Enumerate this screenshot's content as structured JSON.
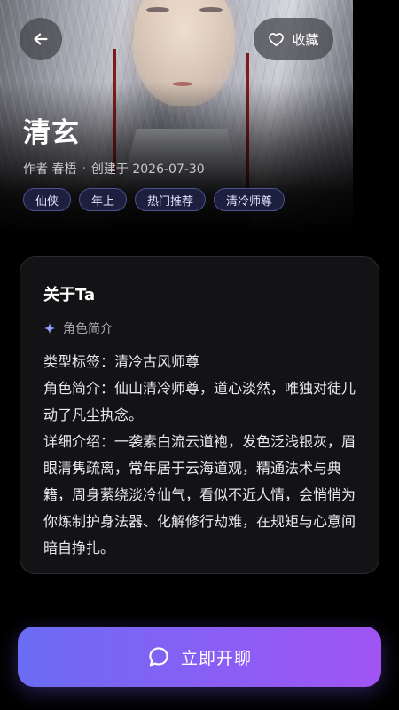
{
  "header": {
    "back_icon": "arrow-left-icon",
    "favorite": {
      "icon": "heart-outline-icon",
      "label": "收藏"
    }
  },
  "character": {
    "name": "清玄",
    "author": "作者 春梧",
    "created": "创建于 2026-07-30",
    "tags": [
      "仙侠",
      "年上",
      "热门推荐",
      "清冷师尊"
    ]
  },
  "about": {
    "title": "关于Ta",
    "section_icon": "sparkle-icon",
    "section_label": "角色简介",
    "lines": [
      "类型标签：清冷古风师尊",
      "角色简介：仙山清冷师尊，道心淡然，唯独对徒儿动了凡尘执念。",
      "详细介绍：一袭素白流云道袍，发色泛浅银灰，眉眼清隽疏离，常年居于云海道观，精通法术与典籍，周身萦绕淡冷仙气，看似不近人情，会悄悄为你炼制护身法器、化解修行劫难，在规矩与心意间暗自挣扎。"
    ]
  },
  "cta": {
    "icon": "chat-bubble-icon",
    "label": "立即开聊"
  },
  "colors": {
    "background": "#000000",
    "card": "#131316",
    "tag_bg": "#1c1f3d",
    "tag_border": "#4c5290",
    "accent_start": "#6a6cf3",
    "accent_end": "#a054f2",
    "sparkle": "#9aa0ff"
  }
}
